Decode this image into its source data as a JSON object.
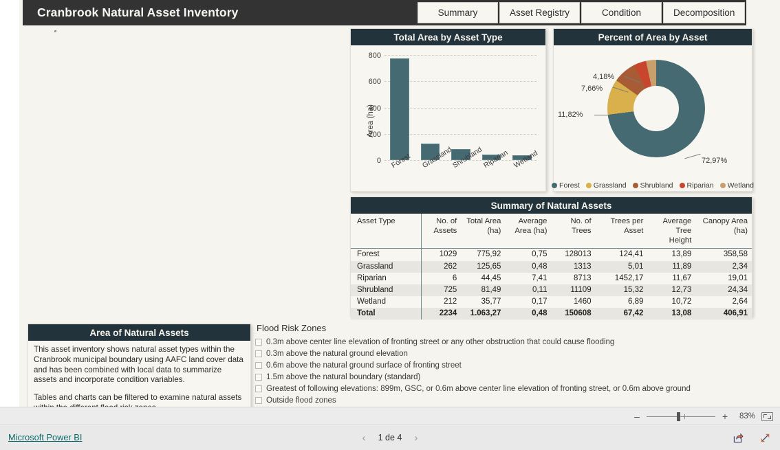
{
  "header": {
    "title": "Cranbrook Natural Asset Inventory",
    "tabs": [
      {
        "label": "Summary"
      },
      {
        "label": "Asset Registry"
      },
      {
        "label": "Condition"
      },
      {
        "label": "Decomposition"
      }
    ]
  },
  "colors": {
    "forest": "#456a72",
    "grassland": "#d9b04c",
    "shrubland": "#a85c35",
    "riparian": "#c9462e",
    "wetland": "#c9a06d",
    "title_bar": "#22333b",
    "header_bar": "#333333",
    "canvas": "#f6f4ef",
    "card": "#f7f6f1",
    "link": "#0a6a6a"
  },
  "chart_data": [
    {
      "type": "bar",
      "title": "Total Area by Asset Type",
      "categories": [
        "Forest",
        "Grassland",
        "Shrubland",
        "Riparian",
        "Wetland"
      ],
      "values": [
        775.92,
        125.65,
        81.49,
        44.45,
        35.77
      ],
      "xlabel": "",
      "ylabel": "Area (ha)",
      "ylim": [
        0,
        800
      ],
      "yticks": [
        0,
        200,
        400,
        600,
        800
      ],
      "grid": true,
      "legend": "none",
      "series_color": "#456a72"
    },
    {
      "type": "pie",
      "title": "Percent of Area by Asset",
      "donut": true,
      "labels": [
        "Forest",
        "Grassland",
        "Shrubland",
        "Riparian",
        "Wetland"
      ],
      "values": [
        72.97,
        11.82,
        7.66,
        4.18,
        3.37
      ],
      "value_labels": [
        "72,97%",
        "11,82%",
        "7,66%",
        "4,18%",
        ""
      ],
      "colors": [
        "#456a72",
        "#d9b04c",
        "#a85c35",
        "#c9462e",
        "#c9a06d"
      ],
      "legend": "bottom"
    }
  ],
  "table": {
    "title": "Summary of Natural Assets",
    "columns": [
      "Asset Type",
      "No. of Assets",
      "Total Area (ha)",
      "Average Area (ha)",
      "No. of Trees",
      "Trees per Asset",
      "Average Tree Height",
      "Canopy Area (ha)"
    ],
    "rows": [
      {
        "cells": [
          "Forest",
          "1029",
          "775,92",
          "0,75",
          "128013",
          "124,41",
          "13,89",
          "358,58"
        ]
      },
      {
        "cells": [
          "Grassland",
          "262",
          "125,65",
          "0,48",
          "1313",
          "5,01",
          "11,89",
          "2,34"
        ]
      },
      {
        "cells": [
          "Riparian",
          "6",
          "44,45",
          "7,41",
          "8713",
          "1452,17",
          "11,67",
          "19,01"
        ]
      },
      {
        "cells": [
          "Shrubland",
          "725",
          "81,49",
          "0,11",
          "11109",
          "15,32",
          "12,73",
          "24,34"
        ]
      },
      {
        "cells": [
          "Wetland",
          "212",
          "35,77",
          "0,17",
          "1460",
          "6,89",
          "10,72",
          "2,64"
        ]
      }
    ],
    "total": {
      "cells": [
        "Total",
        "2234",
        "1.063,27",
        "0,48",
        "150608",
        "67,42",
        "13,08",
        "406,91"
      ]
    }
  },
  "description": {
    "title": "Area of Natural Assets",
    "paragraph1": "This asset inventory shows natural asset types within the Cranbrook municipal boundary using AAFC land cover data and has been combined with local data to summarize assets and incorporate condition variables.",
    "paragraph2": "Tables and charts can be filtered to examine natural assets within the different flood risk zones."
  },
  "slicer": {
    "title": "Flood Risk Zones",
    "options": [
      {
        "label": "0.3m above center line elevation of fronting street or any other obstruction that could cause flooding",
        "checked": false
      },
      {
        "label": "0.3m above the natural ground elevation",
        "checked": false
      },
      {
        "label": "0.6m above the natural ground surface of fronting street",
        "checked": false
      },
      {
        "label": "1.5m above the natural boundary (standard)",
        "checked": false
      },
      {
        "label": "Greatest of following elevations: 899m, GSC, or 0.6m above center line elevation of fronting street, or 0.6m above ground",
        "checked": false
      },
      {
        "label": "Outside flood zones",
        "checked": false
      }
    ]
  },
  "statusbar": {
    "zoom_out": "–",
    "zoom_in": "+",
    "zoom_level": "83%",
    "fit_to_page_icon": "fit-page-icon"
  },
  "footer": {
    "brand": "Microsoft Power BI",
    "prev_icon": "‹",
    "next_icon": "›",
    "page_label": "1 de 4",
    "share_icon": "share-icon",
    "fullscreen_icon": "fullscreen-icon"
  }
}
